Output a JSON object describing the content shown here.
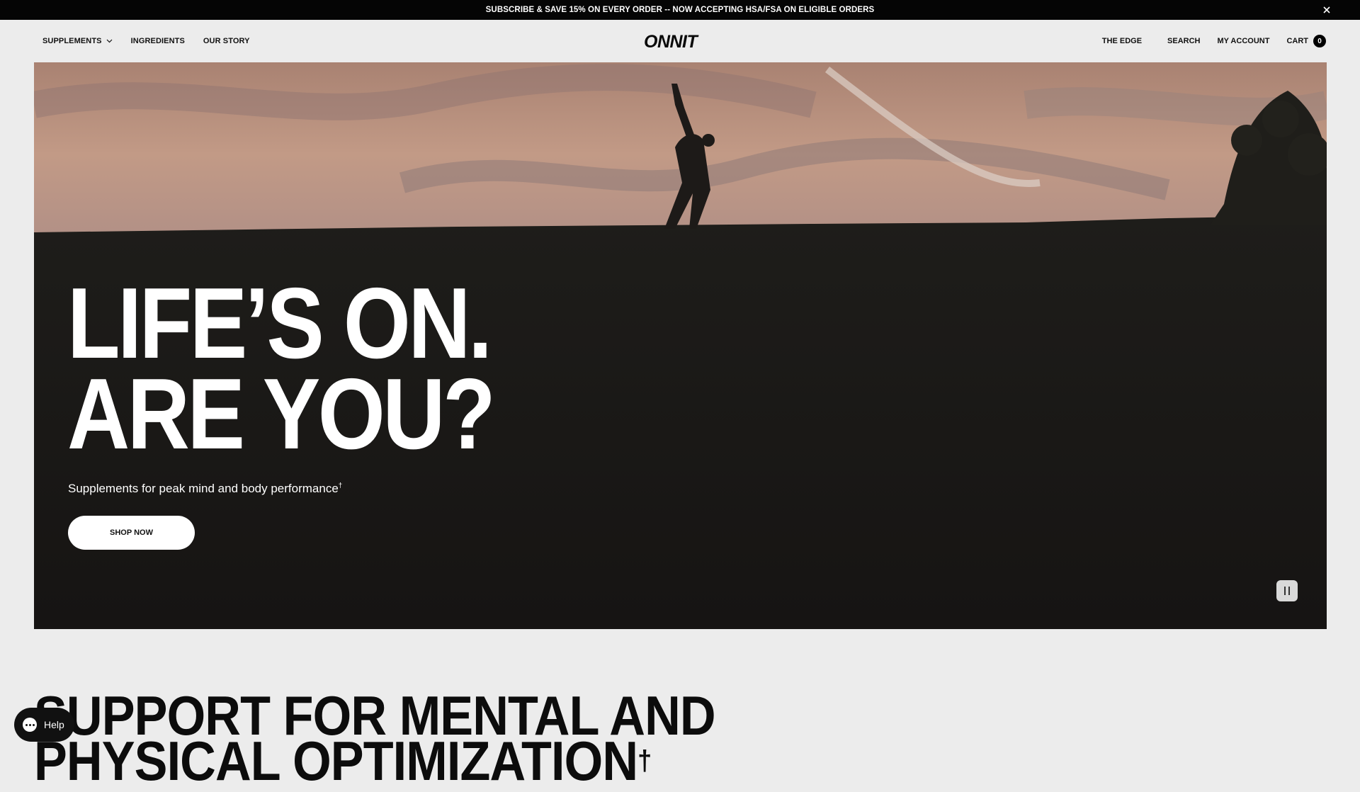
{
  "announcement": {
    "text": "SUBSCRIBE & SAVE 15% ON EVERY ORDER -- NOW ACCEPTING HSA/FSA ON ELIGIBLE ORDERS",
    "close_icon": "close-icon"
  },
  "header": {
    "logo_text": "ONNIT",
    "nav_left": [
      {
        "label": "SUPPLEMENTS",
        "icon": "chevron-down-icon"
      },
      {
        "label": "INGREDIENTS"
      },
      {
        "label": "OUR STORY"
      }
    ],
    "nav_right": {
      "the_edge": "THE EDGE",
      "search": "SEARCH",
      "account": "MY ACCOUNT",
      "cart": "CART",
      "cart_count": "0"
    }
  },
  "hero": {
    "title_line1": "LIFE’S ON.",
    "title_line2": "ARE YOU?",
    "subtitle": "Supplements for peak mind and body performance",
    "subtitle_mark": "†",
    "cta_label": "SHOP NOW",
    "pause_icon": "pause-icon"
  },
  "section": {
    "heading_line1": "SUPPORT FOR MENTAL AND",
    "heading_line2": "PHYSICAL OPTIMIZATION",
    "heading_mark": "†"
  },
  "help_widget": {
    "label": "Help",
    "icon": "chat-bubble-icon"
  },
  "colors": {
    "announcement_bg": "#050505",
    "page_bg": "#ececec",
    "hero_sky": "#b48a78",
    "hero_ground": "#1b1a18",
    "button_bg": "#ffffff"
  }
}
